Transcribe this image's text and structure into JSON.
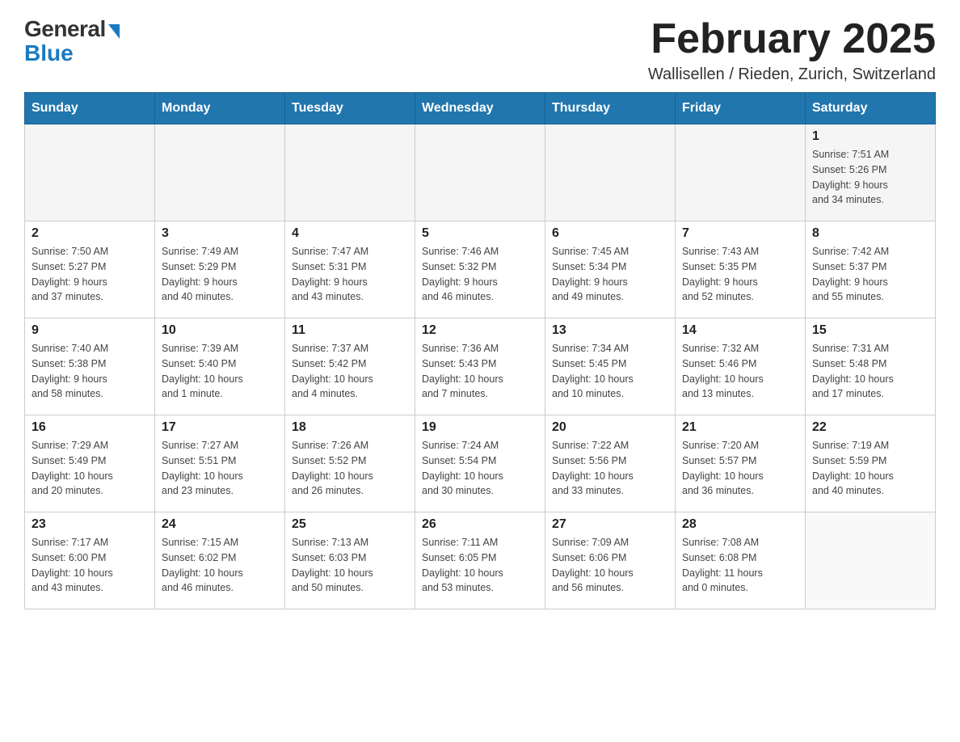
{
  "header": {
    "logo_general": "General",
    "logo_blue": "Blue",
    "month_title": "February 2025",
    "location": "Wallisellen / Rieden, Zurich, Switzerland"
  },
  "calendar": {
    "days_of_week": [
      "Sunday",
      "Monday",
      "Tuesday",
      "Wednesday",
      "Thursday",
      "Friday",
      "Saturday"
    ],
    "weeks": [
      {
        "days": [
          {
            "number": "",
            "info": ""
          },
          {
            "number": "",
            "info": ""
          },
          {
            "number": "",
            "info": ""
          },
          {
            "number": "",
            "info": ""
          },
          {
            "number": "",
            "info": ""
          },
          {
            "number": "",
            "info": ""
          },
          {
            "number": "1",
            "info": "Sunrise: 7:51 AM\nSunset: 5:26 PM\nDaylight: 9 hours\nand 34 minutes."
          }
        ]
      },
      {
        "days": [
          {
            "number": "2",
            "info": "Sunrise: 7:50 AM\nSunset: 5:27 PM\nDaylight: 9 hours\nand 37 minutes."
          },
          {
            "number": "3",
            "info": "Sunrise: 7:49 AM\nSunset: 5:29 PM\nDaylight: 9 hours\nand 40 minutes."
          },
          {
            "number": "4",
            "info": "Sunrise: 7:47 AM\nSunset: 5:31 PM\nDaylight: 9 hours\nand 43 minutes."
          },
          {
            "number": "5",
            "info": "Sunrise: 7:46 AM\nSunset: 5:32 PM\nDaylight: 9 hours\nand 46 minutes."
          },
          {
            "number": "6",
            "info": "Sunrise: 7:45 AM\nSunset: 5:34 PM\nDaylight: 9 hours\nand 49 minutes."
          },
          {
            "number": "7",
            "info": "Sunrise: 7:43 AM\nSunset: 5:35 PM\nDaylight: 9 hours\nand 52 minutes."
          },
          {
            "number": "8",
            "info": "Sunrise: 7:42 AM\nSunset: 5:37 PM\nDaylight: 9 hours\nand 55 minutes."
          }
        ]
      },
      {
        "days": [
          {
            "number": "9",
            "info": "Sunrise: 7:40 AM\nSunset: 5:38 PM\nDaylight: 9 hours\nand 58 minutes."
          },
          {
            "number": "10",
            "info": "Sunrise: 7:39 AM\nSunset: 5:40 PM\nDaylight: 10 hours\nand 1 minute."
          },
          {
            "number": "11",
            "info": "Sunrise: 7:37 AM\nSunset: 5:42 PM\nDaylight: 10 hours\nand 4 minutes."
          },
          {
            "number": "12",
            "info": "Sunrise: 7:36 AM\nSunset: 5:43 PM\nDaylight: 10 hours\nand 7 minutes."
          },
          {
            "number": "13",
            "info": "Sunrise: 7:34 AM\nSunset: 5:45 PM\nDaylight: 10 hours\nand 10 minutes."
          },
          {
            "number": "14",
            "info": "Sunrise: 7:32 AM\nSunset: 5:46 PM\nDaylight: 10 hours\nand 13 minutes."
          },
          {
            "number": "15",
            "info": "Sunrise: 7:31 AM\nSunset: 5:48 PM\nDaylight: 10 hours\nand 17 minutes."
          }
        ]
      },
      {
        "days": [
          {
            "number": "16",
            "info": "Sunrise: 7:29 AM\nSunset: 5:49 PM\nDaylight: 10 hours\nand 20 minutes."
          },
          {
            "number": "17",
            "info": "Sunrise: 7:27 AM\nSunset: 5:51 PM\nDaylight: 10 hours\nand 23 minutes."
          },
          {
            "number": "18",
            "info": "Sunrise: 7:26 AM\nSunset: 5:52 PM\nDaylight: 10 hours\nand 26 minutes."
          },
          {
            "number": "19",
            "info": "Sunrise: 7:24 AM\nSunset: 5:54 PM\nDaylight: 10 hours\nand 30 minutes."
          },
          {
            "number": "20",
            "info": "Sunrise: 7:22 AM\nSunset: 5:56 PM\nDaylight: 10 hours\nand 33 minutes."
          },
          {
            "number": "21",
            "info": "Sunrise: 7:20 AM\nSunset: 5:57 PM\nDaylight: 10 hours\nand 36 minutes."
          },
          {
            "number": "22",
            "info": "Sunrise: 7:19 AM\nSunset: 5:59 PM\nDaylight: 10 hours\nand 40 minutes."
          }
        ]
      },
      {
        "days": [
          {
            "number": "23",
            "info": "Sunrise: 7:17 AM\nSunset: 6:00 PM\nDaylight: 10 hours\nand 43 minutes."
          },
          {
            "number": "24",
            "info": "Sunrise: 7:15 AM\nSunset: 6:02 PM\nDaylight: 10 hours\nand 46 minutes."
          },
          {
            "number": "25",
            "info": "Sunrise: 7:13 AM\nSunset: 6:03 PM\nDaylight: 10 hours\nand 50 minutes."
          },
          {
            "number": "26",
            "info": "Sunrise: 7:11 AM\nSunset: 6:05 PM\nDaylight: 10 hours\nand 53 minutes."
          },
          {
            "number": "27",
            "info": "Sunrise: 7:09 AM\nSunset: 6:06 PM\nDaylight: 10 hours\nand 56 minutes."
          },
          {
            "number": "28",
            "info": "Sunrise: 7:08 AM\nSunset: 6:08 PM\nDaylight: 11 hours\nand 0 minutes."
          },
          {
            "number": "",
            "info": ""
          }
        ]
      }
    ]
  }
}
